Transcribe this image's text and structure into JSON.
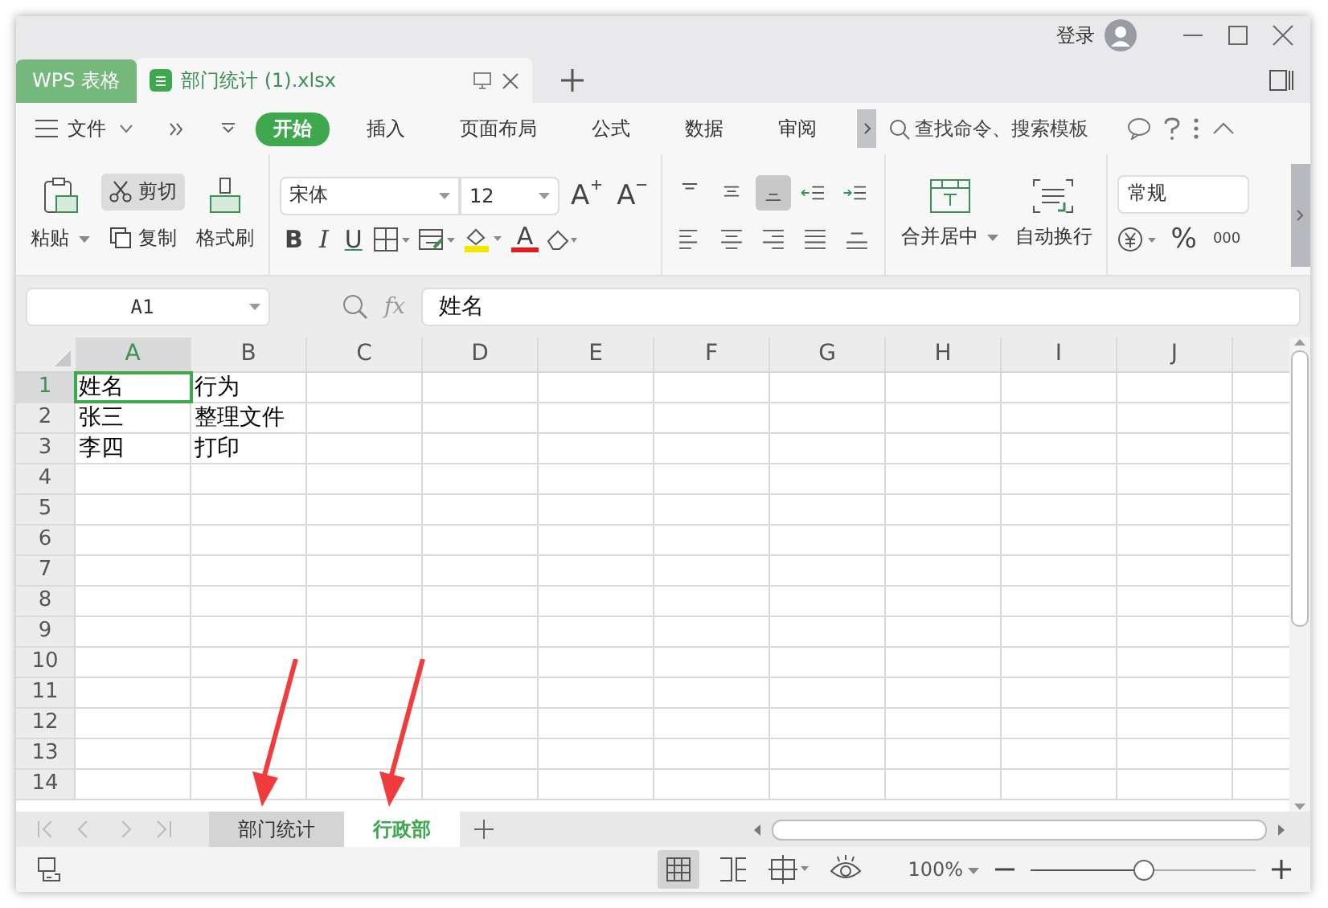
{
  "title_bar": {
    "login": "登录"
  },
  "doc_tabs": [
    {
      "label": "WPS 表格",
      "kind": "app",
      "selected": false
    },
    {
      "label": "部门统计 (1).xlsx",
      "kind": "file",
      "selected": true
    }
  ],
  "menu": {
    "file": "文件",
    "tabs": [
      {
        "label": "开始",
        "selected": true
      },
      {
        "label": "插入",
        "selected": false
      },
      {
        "label": "页面布局",
        "selected": false
      },
      {
        "label": "公式",
        "selected": false
      },
      {
        "label": "数据",
        "selected": false
      },
      {
        "label": "审阅",
        "selected": false
      }
    ],
    "search_placeholder": "查找命令、搜索模板"
  },
  "ribbon": {
    "paste": "粘贴",
    "cut": "剪切",
    "copy": "复制",
    "format_painter": "格式刷",
    "font": "宋体",
    "size": "12",
    "grow": "A",
    "shrink": "A",
    "bold": "B",
    "italic": "I",
    "underline": "U",
    "font_color": "A",
    "merge": "合并居中",
    "wrap": "自动换行",
    "number_format": "常规",
    "percent": "%",
    "thousands": "000"
  },
  "formula_bar": {
    "cell_ref": "A1",
    "fx": "fx",
    "value": "姓名"
  },
  "grid": {
    "columns": [
      {
        "label": "A",
        "selected": true
      },
      {
        "label": "B",
        "selected": false
      },
      {
        "label": "C",
        "selected": false
      },
      {
        "label": "D",
        "selected": false
      },
      {
        "label": "E",
        "selected": false
      },
      {
        "label": "F",
        "selected": false
      },
      {
        "label": "G",
        "selected": false
      },
      {
        "label": "H",
        "selected": false
      },
      {
        "label": "I",
        "selected": false
      },
      {
        "label": "J",
        "selected": false
      }
    ],
    "rows": [
      {
        "label": "1",
        "selected": true
      },
      {
        "label": "2",
        "selected": false
      },
      {
        "label": "3",
        "selected": false
      },
      {
        "label": "4",
        "selected": false
      },
      {
        "label": "5",
        "selected": false
      },
      {
        "label": "6",
        "selected": false
      },
      {
        "label": "7",
        "selected": false
      },
      {
        "label": "8",
        "selected": false
      },
      {
        "label": "9",
        "selected": false
      },
      {
        "label": "10",
        "selected": false
      },
      {
        "label": "11",
        "selected": false
      },
      {
        "label": "12",
        "selected": false
      },
      {
        "label": "13",
        "selected": false
      },
      {
        "label": "14",
        "selected": false
      }
    ],
    "cells": [
      [
        "姓名",
        "行为"
      ],
      [
        "张三",
        "整理文件"
      ],
      [
        "李四",
        "打印"
      ]
    ]
  },
  "sheets": [
    {
      "label": "部门统计",
      "selected": false
    },
    {
      "label": "行政部",
      "selected": true
    }
  ],
  "status": {
    "zoom": "100%",
    "zoom_slider": {
      "level": 0.5
    }
  }
}
